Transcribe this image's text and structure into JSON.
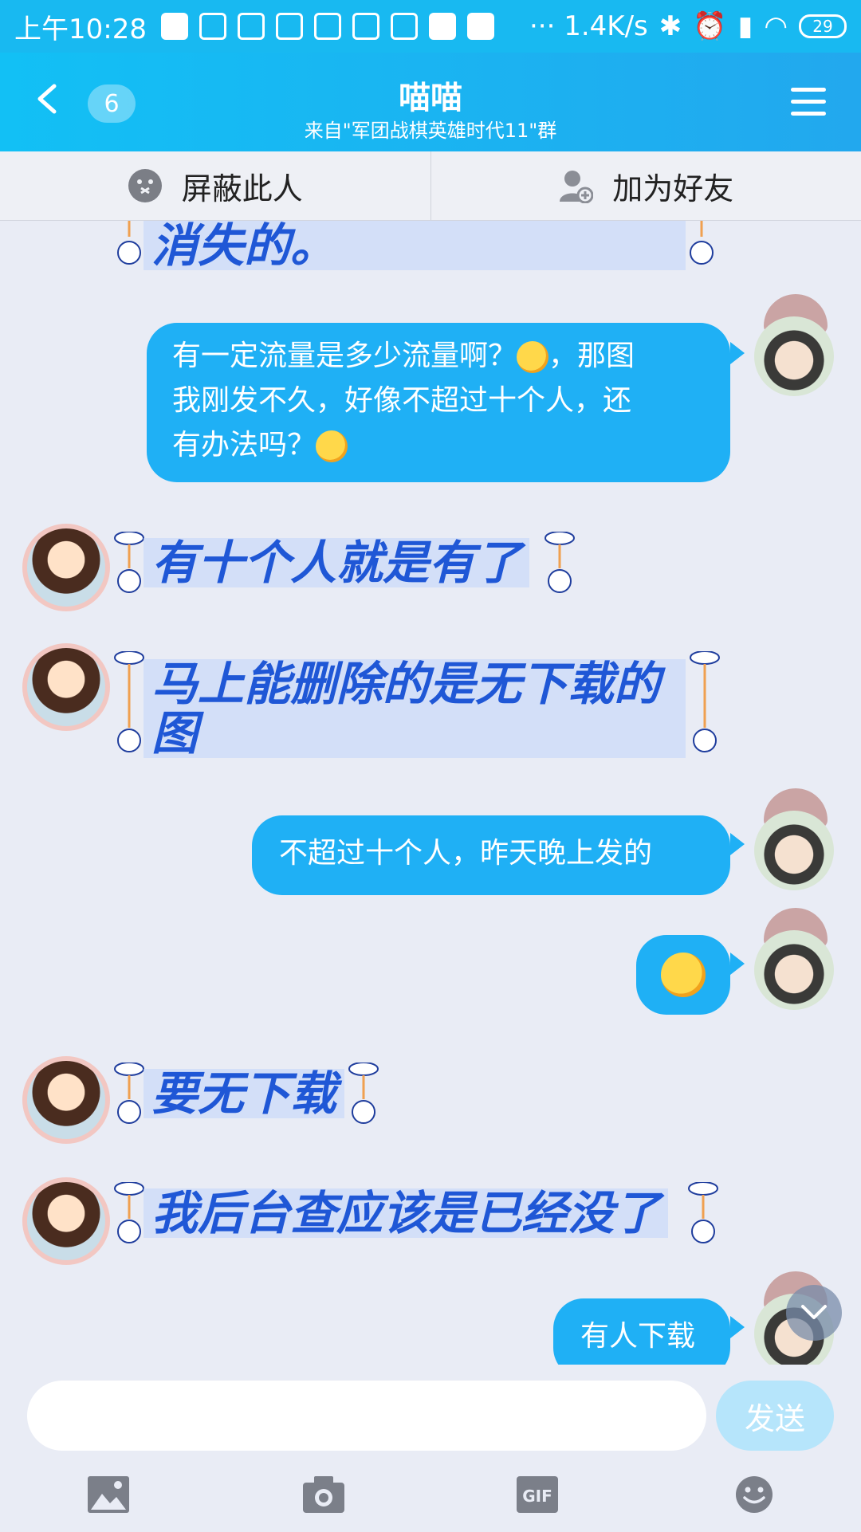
{
  "status_bar": {
    "time": "上午10:28",
    "net_speed": "··· 1.4K/s",
    "battery": "29"
  },
  "nav": {
    "unread_count": "6",
    "title": "喵喵",
    "subtitle": "来自\"军团战棋英雄时代11\"群"
  },
  "actions": {
    "block_label": "屏蔽此人",
    "add_friend_label": "加为好友"
  },
  "messages": [
    {
      "side": "left",
      "text": "消失的。"
    },
    {
      "side": "right",
      "text_line1": "有一定流量是多少流量啊？",
      "text_line1b": "，那图",
      "text_line2": "我刚发不久，好像不超过十个人，还",
      "text_line3": "有办法吗？"
    },
    {
      "side": "left",
      "text": "有十个人就是有了"
    },
    {
      "side": "left",
      "text_line1": "马上能删除的是无下载的",
      "text_line2": "图"
    },
    {
      "side": "right",
      "text": "不超过十个人，昨天晚上发的"
    },
    {
      "side": "right",
      "emoji": "laugh-cry-emoji"
    },
    {
      "side": "left",
      "text": "要无下载"
    },
    {
      "side": "left",
      "text": "我后台查应该是已经没了"
    },
    {
      "side": "right",
      "text": "有人下载"
    }
  ],
  "input": {
    "placeholder": "",
    "send_label": "发送"
  },
  "colors": {
    "accent": "#1fb0f5",
    "left_text": "#1f57d6"
  }
}
